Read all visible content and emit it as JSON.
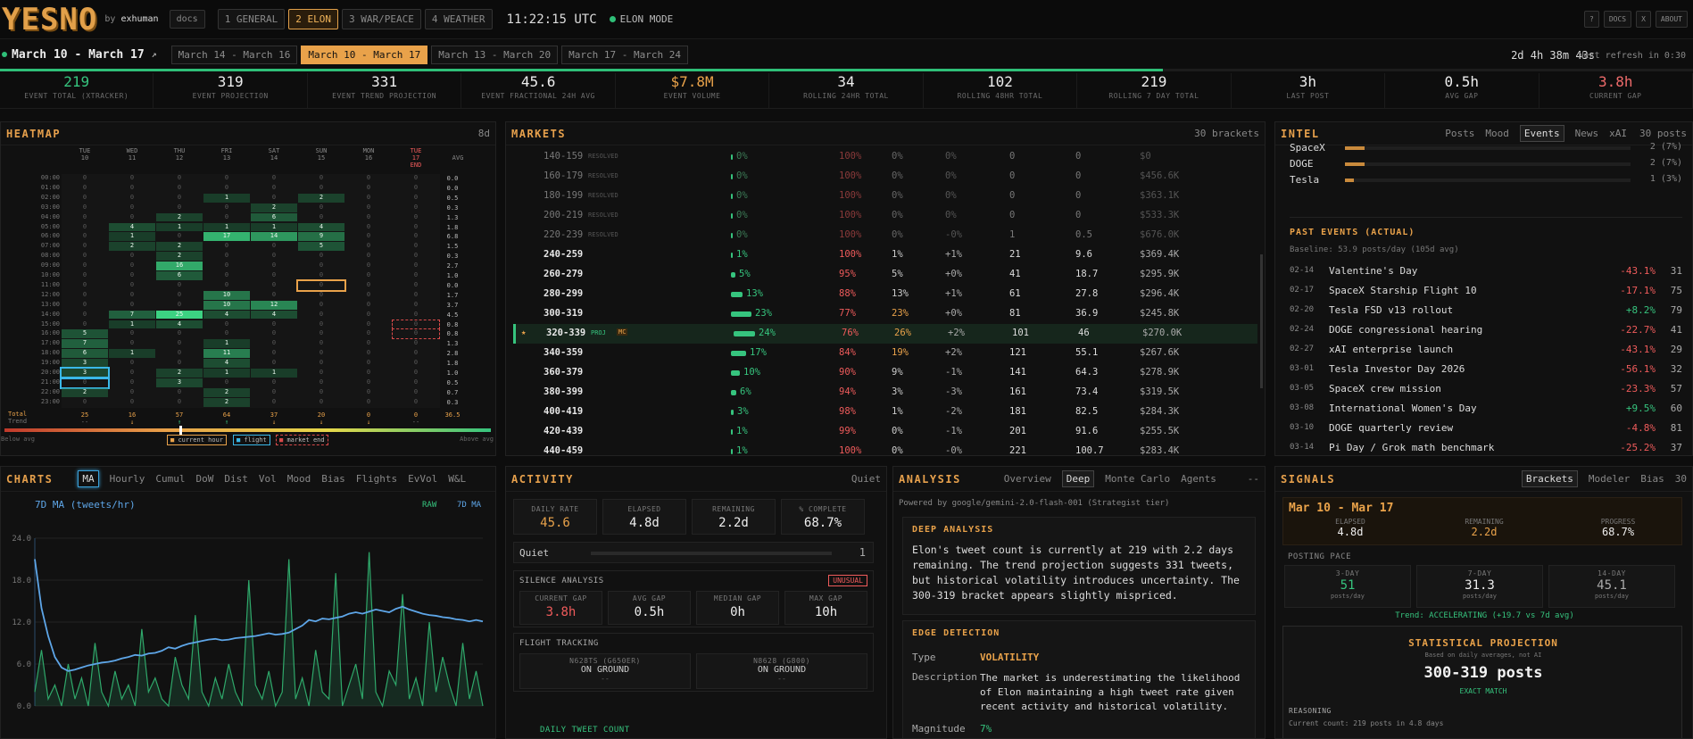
{
  "header": {
    "logo": "YESNO",
    "by_prefix": "by",
    "by_user": "exhuman",
    "docs": "docs",
    "tabs": [
      "1 GENERAL",
      "2 ELON",
      "3 WAR/PEACE",
      "4 WEATHER"
    ],
    "clock": "11:22:15 UTC",
    "mode": "ELON MODE",
    "right_buttons": [
      "?",
      "DOCS",
      "X",
      "ABOUT"
    ]
  },
  "brackets": {
    "current": "March 10 - March 17",
    "arrow": "↗",
    "tabs": [
      "March 14 - March 16",
      "March 10 - March 17",
      "March 13 - March 20",
      "March 17 - March 24"
    ],
    "active_index": 1,
    "countdown": "2d 4h 38m 43s",
    "next_refresh": "Next refresh in 0:30",
    "progress": 0.687
  },
  "stats": [
    {
      "v": "219",
      "l": "EVENT TOTAL (XTRACKER)",
      "color": "#36c47e"
    },
    {
      "v": "319",
      "l": "EVENT PROJECTION",
      "color": "#eeeeee"
    },
    {
      "v": "331",
      "l": "EVENT TREND PROJECTION",
      "color": "#eeeeee"
    },
    {
      "v": "45.6",
      "l": "EVENT FRACTIONAL 24H AVG",
      "color": "#eeeeee"
    },
    {
      "v": "$7.8M",
      "l": "EVENT VOLUME",
      "color": "#e9a24a"
    },
    {
      "v": "34",
      "l": "ROLLING 24HR TOTAL",
      "color": "#eeeeee"
    },
    {
      "v": "102",
      "l": "ROLLING 48HR TOTAL",
      "color": "#eeeeee"
    },
    {
      "v": "219",
      "l": "ROLLING 7 DAY TOTAL",
      "color": "#eeeeee"
    },
    {
      "v": "3h",
      "l": "LAST POST",
      "color": "#eeeeee"
    },
    {
      "v": "0.5h",
      "l": "AVG GAP",
      "color": "#eeeeee"
    },
    {
      "v": "3.8h",
      "l": "CURRENT GAP",
      "color": "#ef6b6b"
    }
  ],
  "heatmap": {
    "title": "HEATMAP",
    "days_label": "8d",
    "days": [
      [
        "TUE",
        "10"
      ],
      [
        "WED",
        "11"
      ],
      [
        "THU",
        "12"
      ],
      [
        "FRI",
        "13"
      ],
      [
        "SAT",
        "14"
      ],
      [
        "SUN",
        "15"
      ],
      [
        "MON",
        "16"
      ],
      [
        "TUE",
        "17"
      ]
    ],
    "end_label": "END",
    "avg_label": "AVG",
    "hours": [
      "00:00",
      "01:00",
      "02:00",
      "03:00",
      "04:00",
      "05:00",
      "06:00",
      "07:00",
      "08:00",
      "09:00",
      "10:00",
      "11:00",
      "12:00",
      "13:00",
      "14:00",
      "15:00",
      "16:00",
      "17:00",
      "18:00",
      "19:00",
      "20:00",
      "21:00",
      "22:00",
      "23:00"
    ],
    "grid": [
      [
        0,
        0,
        0,
        0,
        0,
        0,
        0,
        0
      ],
      [
        0,
        0,
        0,
        0,
        0,
        0,
        0,
        0
      ],
      [
        0,
        0,
        0,
        1,
        0,
        2,
        0,
        0
      ],
      [
        0,
        0,
        0,
        0,
        2,
        0,
        0,
        0
      ],
      [
        0,
        0,
        2,
        0,
        6,
        0,
        0,
        0
      ],
      [
        0,
        4,
        1,
        1,
        1,
        4,
        0,
        0
      ],
      [
        0,
        1,
        0,
        17,
        14,
        9,
        0,
        0
      ],
      [
        0,
        2,
        2,
        0,
        0,
        5,
        0,
        0
      ],
      [
        0,
        0,
        2,
        0,
        0,
        0,
        0,
        0
      ],
      [
        0,
        0,
        16,
        0,
        0,
        0,
        0,
        0
      ],
      [
        0,
        0,
        6,
        0,
        0,
        0,
        0,
        0
      ],
      [
        0,
        0,
        0,
        0,
        0,
        0,
        0,
        0
      ],
      [
        0,
        0,
        0,
        10,
        0,
        0,
        0,
        0
      ],
      [
        0,
        0,
        0,
        10,
        12,
        0,
        0,
        0
      ],
      [
        0,
        7,
        25,
        4,
        4,
        0,
        0,
        0
      ],
      [
        0,
        1,
        4,
        0,
        0,
        0,
        0,
        0
      ],
      [
        5,
        0,
        0,
        0,
        0,
        0,
        0,
        0
      ],
      [
        7,
        0,
        0,
        1,
        0,
        0,
        0,
        0
      ],
      [
        6,
        1,
        0,
        11,
        0,
        0,
        0,
        0
      ],
      [
        3,
        0,
        0,
        4,
        0,
        0,
        0,
        0
      ],
      [
        3,
        0,
        2,
        1,
        1,
        0,
        0,
        0
      ],
      [
        0,
        0,
        3,
        0,
        0,
        0,
        0,
        0
      ],
      [
        2,
        0,
        0,
        2,
        0,
        0,
        0,
        0
      ],
      [
        0,
        0,
        0,
        2,
        0,
        0,
        0,
        0
      ]
    ],
    "avgs": [
      "0.0",
      "0.0",
      "0.5",
      "0.3",
      "1.3",
      "1.8",
      "6.8",
      "1.5",
      "0.3",
      "2.7",
      "1.0",
      "0.0",
      "1.7",
      "3.7",
      "4.5",
      "0.8",
      "0.8",
      "1.3",
      "2.8",
      "1.8",
      "1.0",
      "0.5",
      "0.7",
      "0.3"
    ],
    "totals_label": "Total",
    "totals": [
      "25",
      "16",
      "57",
      "64",
      "37",
      "20",
      "0",
      "0"
    ],
    "total_avg": "36.5",
    "trend_label": "Trend",
    "trend": [
      "--",
      "↓",
      "↑",
      "↑",
      "↓",
      "↓",
      "↓",
      "--"
    ],
    "below_avg": "Below avg",
    "above_avg": "Above avg",
    "legend": [
      "current hour",
      "flight",
      "market end"
    ]
  },
  "markets": {
    "title": "MARKETS",
    "count": "30 brackets",
    "rows": [
      [
        "140-159",
        "RESOLVED",
        "0%",
        "100%",
        "0%",
        "0%",
        "0",
        "0",
        "$0"
      ],
      [
        "160-179",
        "RESOLVED",
        "0%",
        "100%",
        "0%",
        "0%",
        "0",
        "0",
        "$456.6K"
      ],
      [
        "180-199",
        "RESOLVED",
        "0%",
        "100%",
        "0%",
        "0%",
        "0",
        "0",
        "$363.1K"
      ],
      [
        "200-219",
        "RESOLVED",
        "0%",
        "100%",
        "0%",
        "0%",
        "0",
        "0",
        "$533.3K"
      ],
      [
        "220-239",
        "RESOLVED",
        "0%",
        "100%",
        "0%",
        "-0%",
        "1",
        "0.5",
        "$676.0K"
      ],
      [
        "240-259",
        "",
        "1%",
        "100%",
        "1%",
        "+1%",
        "21",
        "9.6",
        "$369.4K"
      ],
      [
        "260-279",
        "",
        "5%",
        "95%",
        "5%",
        "+0%",
        "41",
        "18.7",
        "$295.9K"
      ],
      [
        "280-299",
        "",
        "13%",
        "88%",
        "13%",
        "+1%",
        "61",
        "27.8",
        "$296.4K"
      ],
      [
        "300-319",
        "",
        "23%",
        "77%",
        "23%",
        "+0%",
        "81",
        "36.9",
        "$245.8K"
      ],
      [
        "320-339",
        "PROJ",
        "24%",
        "76%",
        "26%",
        "+2%",
        "101",
        "46",
        "$270.0K"
      ],
      [
        "340-359",
        "",
        "17%",
        "84%",
        "19%",
        "+2%",
        "121",
        "55.1",
        "$267.6K"
      ],
      [
        "360-379",
        "",
        "10%",
        "90%",
        "9%",
        "-1%",
        "141",
        "64.3",
        "$278.9K"
      ],
      [
        "380-399",
        "",
        "6%",
        "94%",
        "3%",
        "-3%",
        "161",
        "73.4",
        "$319.5K"
      ],
      [
        "400-419",
        "",
        "3%",
        "98%",
        "1%",
        "-2%",
        "181",
        "82.5",
        "$284.3K"
      ],
      [
        "420-439",
        "",
        "1%",
        "99%",
        "0%",
        "-1%",
        "201",
        "91.6",
        "$255.5K"
      ],
      [
        "440-459",
        "",
        "1%",
        "100%",
        "0%",
        "-0%",
        "221",
        "100.7",
        "$283.4K"
      ]
    ],
    "mc": "MC",
    "star": "★"
  },
  "intel": {
    "title": "INTEL",
    "tabs": [
      "Posts",
      "Mood",
      "Events",
      "News",
      "xAI"
    ],
    "active_tab": "Events",
    "count": "30 posts",
    "topics": [
      {
        "name": "SpaceX",
        "val": "2 (7%)",
        "frac": 0.07
      },
      {
        "name": "DOGE",
        "val": "2 (7%)",
        "frac": 0.07
      },
      {
        "name": "Tesla",
        "val": "1 (3%)",
        "frac": 0.03
      }
    ],
    "past_title": "PAST EVENTS (ACTUAL)",
    "baseline": "Baseline: 53.9 posts/day (105d avg)",
    "events": [
      [
        "02-14",
        "Valentine's Day",
        "-43.1%",
        "31"
      ],
      [
        "02-17",
        "SpaceX Starship Flight 10",
        "-17.1%",
        "75"
      ],
      [
        "02-20",
        "Tesla FSD v13 rollout",
        "+8.2%",
        "79"
      ],
      [
        "02-24",
        "DOGE congressional hearing",
        "-22.7%",
        "41"
      ],
      [
        "02-27",
        "xAI enterprise launch",
        "-43.1%",
        "29"
      ],
      [
        "03-01",
        "Tesla Investor Day 2026",
        "-56.1%",
        "32"
      ],
      [
        "03-05",
        "SpaceX crew mission",
        "-23.3%",
        "57"
      ],
      [
        "03-08",
        "International Women's Day",
        "+9.5%",
        "60"
      ],
      [
        "03-10",
        "DOGE quarterly review",
        "-4.8%",
        "81"
      ],
      [
        "03-14",
        "Pi Day / Grok math benchmark",
        "-25.2%",
        "37"
      ]
    ]
  },
  "charts": {
    "title": "CHARTS",
    "tabs": [
      "MA",
      "Hourly",
      "Cumul",
      "DoW",
      "Dist",
      "Vol",
      "Mood",
      "Bias",
      "Flights",
      "EvVol",
      "W&L"
    ],
    "active_tab": "MA",
    "series_label": "7D MA (tweets/hr)",
    "raw_label": "RAW",
    "ma_label": "7D MA",
    "y_ticks": [
      "24.0",
      "18.0",
      "12.0",
      "6.0",
      "0.0"
    ]
  },
  "chart_data": {
    "type": "line",
    "ylim": [
      0,
      24
    ],
    "series": [
      {
        "name": "7D MA",
        "values": [
          21,
          14,
          10,
          7,
          5.5,
          5,
          5.2,
          5.5,
          5.8,
          6,
          6.2,
          6.3,
          6.5,
          6.8,
          7,
          7.3,
          7.2,
          7.5,
          7.6,
          7.9,
          8.4,
          8.2,
          8.6,
          8.9,
          9.1,
          9.3,
          9.5,
          9.6,
          9.4,
          9.5,
          9.7,
          9.8,
          9.9,
          10,
          10.2,
          10.4,
          10.2,
          10.3,
          10.5,
          11,
          11.5,
          12.3,
          12.1,
          12.5,
          12.4,
          12.6,
          12.8,
          13.2,
          13.4,
          13.2,
          13.5,
          13.8,
          13.6,
          13.4,
          13.9,
          14.2,
          13.8,
          13.5,
          13.2,
          13,
          12.9,
          12.7,
          12.6,
          12.4,
          12.3,
          12.1,
          12.3,
          12.1
        ]
      },
      {
        "name": "RAW",
        "values": [
          2,
          8,
          1,
          3,
          0,
          6,
          1,
          4,
          0,
          9,
          2,
          0,
          5,
          1,
          3,
          0,
          11,
          2,
          4,
          1,
          0,
          7,
          3,
          1,
          13,
          2,
          0,
          4,
          1,
          6,
          2,
          0,
          18,
          3,
          1,
          5,
          0,
          2,
          21,
          1,
          4,
          0,
          8,
          2,
          1,
          19,
          0,
          3,
          6,
          1,
          22,
          2,
          0,
          5,
          3,
          16,
          1,
          4,
          0,
          12,
          2,
          7,
          3,
          0,
          9,
          1,
          5,
          0
        ]
      }
    ]
  },
  "activity": {
    "title": "ACTIVITY",
    "status": "Quiet",
    "boxes": [
      {
        "l": "DAILY RATE",
        "v": "45.6",
        "color": "#e9a24a"
      },
      {
        "l": "ELAPSED",
        "v": "4.8d",
        "color": "#eeeeee"
      },
      {
        "l": "REMAINING",
        "v": "2.2d",
        "color": "#eeeeee"
      },
      {
        "l": "% COMPLETE",
        "v": "68.7%",
        "color": "#eeeeee"
      }
    ],
    "quiet_label": "Quiet",
    "quiet_value": "1",
    "silence_title": "SILENCE ANALYSIS",
    "unusual": "UNUSUAL",
    "silence": [
      {
        "l": "CURRENT GAP",
        "v": "3.8h",
        "color": "#ef5b5b"
      },
      {
        "l": "AVG GAP",
        "v": "0.5h",
        "color": "#eeeeee"
      },
      {
        "l": "MEDIAN GAP",
        "v": "0h",
        "color": "#eeeeee"
      },
      {
        "l": "MAX GAP",
        "v": "10h",
        "color": "#eeeeee"
      }
    ],
    "flight_title": "FLIGHT TRACKING",
    "flights": [
      {
        "id": "N628TS (G650ER)",
        "status": "ON GROUND",
        "sub": "--"
      },
      {
        "id": "N8628 (G800)",
        "status": "ON GROUND",
        "sub": "--"
      }
    ],
    "daily_title": "DAILY TWEET COUNT"
  },
  "analysis": {
    "title": "ANALYSIS",
    "tabs": [
      "Overview",
      "Deep",
      "Monte Carlo",
      "Agents"
    ],
    "active_tab": "Deep",
    "more": "--",
    "powered": "Powered by google/gemini-2.0-flash-001 (Strategist tier)",
    "deep_title": "DEEP ANALYSIS",
    "deep_text": "Elon's tweet count is currently at 219 with 2.2 days remaining. The trend projection suggests 331 tweets, but historical volatility introduces uncertainty. The 300-319 bracket appears slightly mispriced.",
    "edge_title": "EDGE DETECTION",
    "type_label": "Type",
    "type_value": "VOLATILITY",
    "desc_label": "Description",
    "desc_value": "The market is underestimating the likelihood of Elon maintaining a high tweet rate given recent activity and historical volatility.",
    "mag_label": "Magnitude",
    "mag_value": "7%"
  },
  "signals": {
    "title": "SIGNALS",
    "tabs": [
      "Brackets",
      "Modeler",
      "Bias",
      "30"
    ],
    "active_tab": "Brackets",
    "range": "Mar 10 - Mar 17",
    "boxes": [
      {
        "l": "ELAPSED",
        "v": "4.8d",
        "color": "#eeeeee"
      },
      {
        "l": "REMAINING",
        "v": "2.2d",
        "color": "#e9a24a"
      },
      {
        "l": "PROGRESS",
        "v": "68.7%",
        "color": "#eeeeee"
      }
    ],
    "pace_title": "POSTING PACE",
    "pace": [
      {
        "l": "3-DAY",
        "v": "51",
        "color": "#36c47e"
      },
      {
        "l": "7-DAY",
        "v": "31.3",
        "color": "#eeeeee"
      },
      {
        "l": "14-DAY",
        "v": "45.1",
        "color": "#aaaaaa"
      }
    ],
    "pace_unit": "posts/day",
    "trend": "Trend: ACCELERATING (+19.7 vs 7d avg)",
    "proj_title": "STATISTICAL PROJECTION",
    "proj_sub": "Based on daily averages, not AI",
    "proj_value": "300-319 posts",
    "proj_match": "EXACT MATCH",
    "reasoning_title": "REASONING",
    "reasoning_text": "Current count: 219 posts in 4.8 days"
  }
}
